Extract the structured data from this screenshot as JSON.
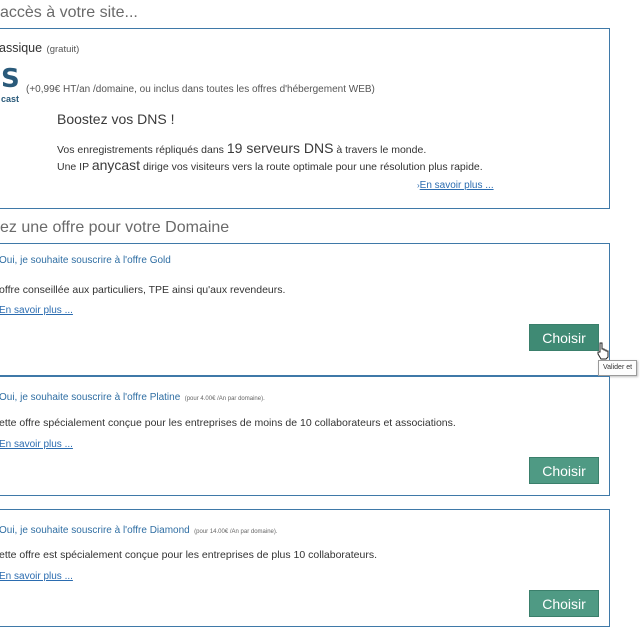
{
  "section1": {
    "title": "accès à votre site...",
    "classique_label": "assique",
    "classique_note": "(gratuit)",
    "logo_letter": "S",
    "logo_text": "cast",
    "price_note": "(+0,99€ HT/an /domaine, ou inclus dans toutes les offres d'hébergement WEB)",
    "boost_title": "Boostez vos DNS !",
    "line1_pre": "Vos enregistrements répliqués dans ",
    "line1_big": "19 serveurs DNS",
    "line1_post": " à travers le monde.",
    "line2_pre": "Une IP ",
    "line2_big": "anycast",
    "line2_post": " dirige vos visiteurs vers la route optimale pour une résolution plus rapide.",
    "learn_more": "En savoir plus ..."
  },
  "section2": {
    "title": "ez une offre pour votre Domaine"
  },
  "offers": [
    {
      "option_label": "Oui, je souhaite souscrire à l'offre Gold",
      "price_note": "",
      "description": "offre conseillée aux particuliers, TPE ainsi qu'aux revendeurs.",
      "learn_more": "En savoir plus ...",
      "button": "Choisir"
    },
    {
      "option_label": "Oui, je souhaite souscrire à l'offre Platine",
      "price_note": "(pour 4.00€ /An par domaine).",
      "description": "ette offre spécialement conçue pour les entreprises de moins de 10 collaborateurs et associations.",
      "learn_more": "En savoir plus ...",
      "button": "Choisir"
    },
    {
      "option_label": "Oui, je souhaite souscrire à l'offre Diamond",
      "price_note": "(pour 14.00€ /An par domaine).",
      "description": "ette offre est spécialement conçue pour les entreprises de plus 10 collaborateurs.",
      "learn_more": "En savoir plus ...",
      "button": "Choisir"
    }
  ],
  "tooltip": "Valider et",
  "colors": {
    "border": "#3f79a8",
    "button": "#4f9a84",
    "link": "#2b6cb0"
  }
}
